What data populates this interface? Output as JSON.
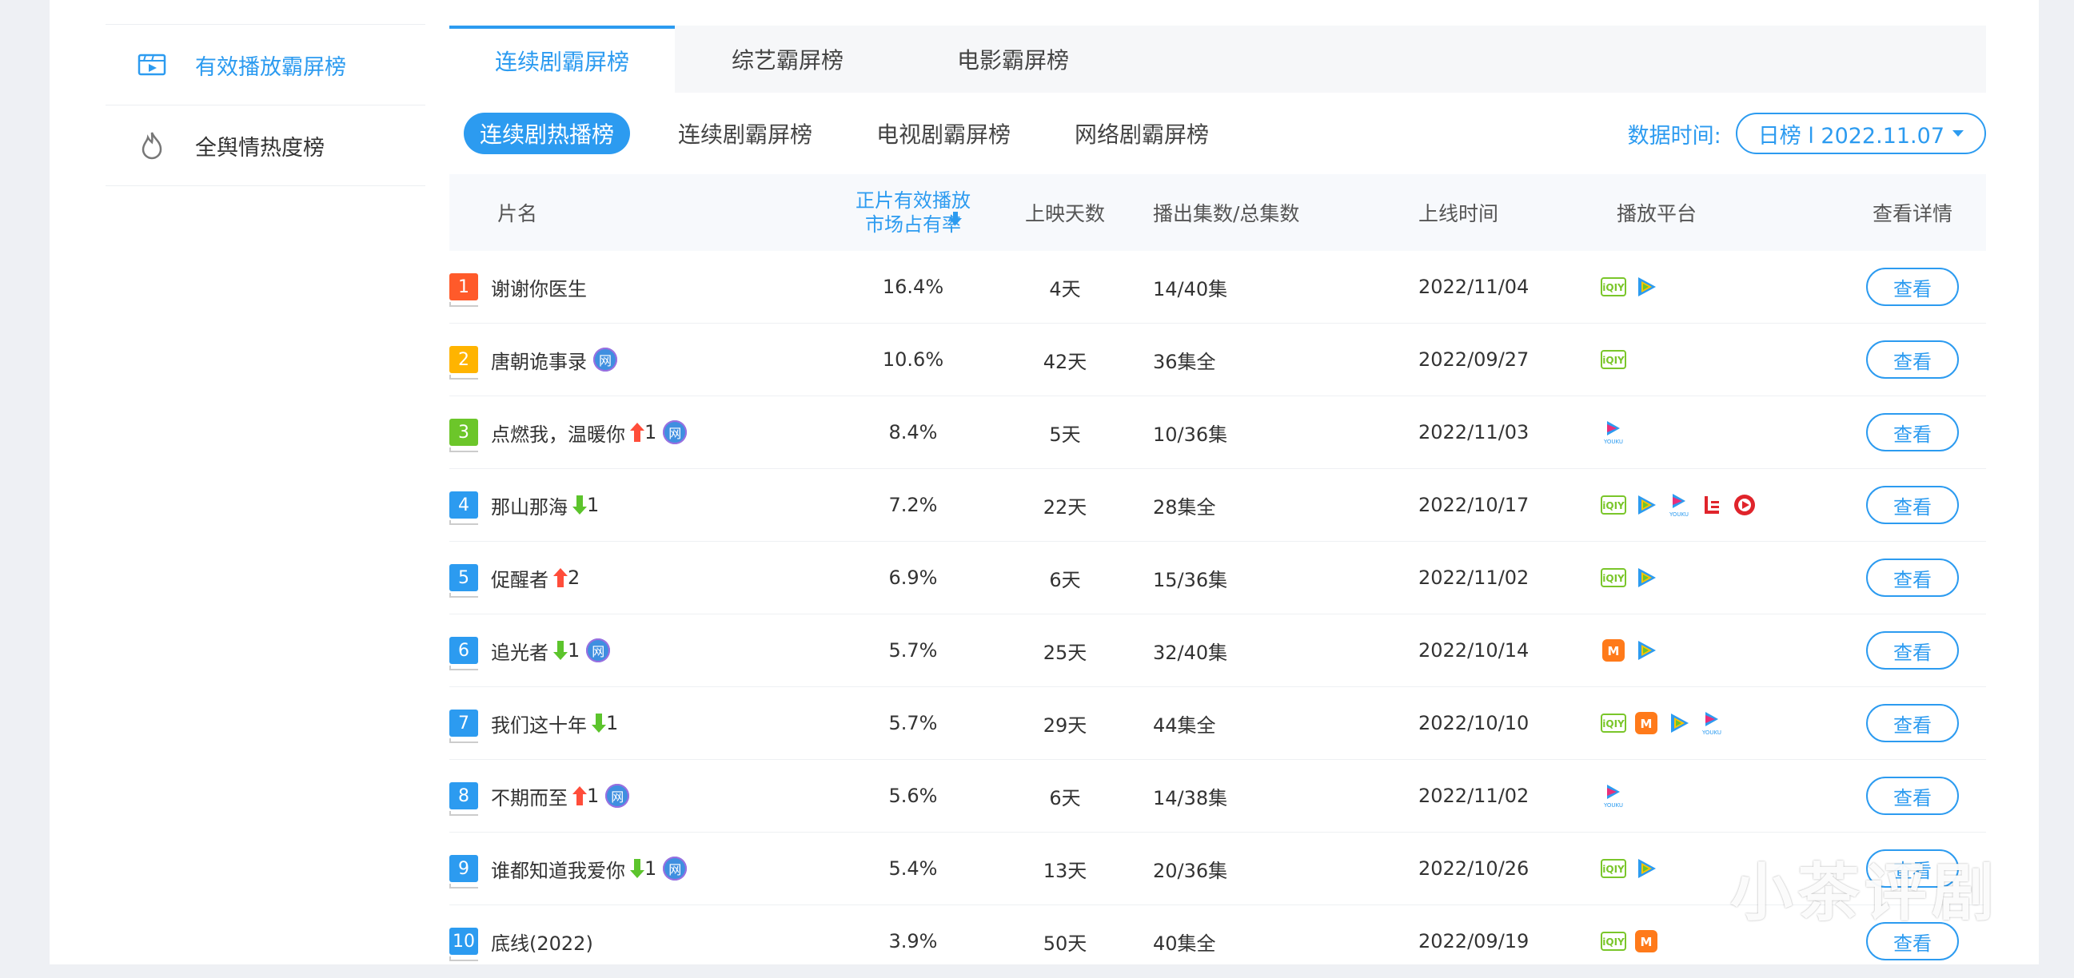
{
  "sidebar": {
    "items": [
      {
        "label": "有效播放霸屏榜",
        "icon": "film-icon",
        "active": true
      },
      {
        "label": "全舆情热度榜",
        "icon": "flame-icon",
        "active": false
      }
    ]
  },
  "top_tabs": [
    {
      "label": "连续剧霸屏榜",
      "active": true
    },
    {
      "label": "综艺霸屏榜",
      "active": false
    },
    {
      "label": "电影霸屏榜",
      "active": false
    }
  ],
  "sub_tabs": [
    {
      "label": "连续剧热播榜",
      "active": true
    },
    {
      "label": "连续剧霸屏榜",
      "active": false
    },
    {
      "label": "电视剧霸屏榜",
      "active": false
    },
    {
      "label": "网络剧霸屏榜",
      "active": false
    }
  ],
  "date": {
    "label": "数据时间:",
    "value": "日榜 l 2022.11.07"
  },
  "table": {
    "headers": {
      "name": "片名",
      "share_line1": "正片有效播放",
      "share_line2": "市场占有率",
      "days": "上映天数",
      "eps": "播出集数/总集数",
      "date": "上线时间",
      "platform": "播放平台",
      "detail": "查看详情"
    },
    "detail_label": "查看",
    "rows": [
      {
        "rank": "1",
        "color": "#ff5a2a",
        "name": "谢谢你医生",
        "trend": "",
        "change": "",
        "net": false,
        "share": "16.4%",
        "days": "4天",
        "eps": "14/40集",
        "date": "2022/11/04",
        "platforms": [
          "iqiyi",
          "tencent"
        ]
      },
      {
        "rank": "2",
        "color": "#ffb400",
        "name": "唐朝诡事录",
        "trend": "",
        "change": "",
        "net": true,
        "share": "10.6%",
        "days": "42天",
        "eps": "36集全",
        "date": "2022/09/27",
        "platforms": [
          "iqiyi"
        ]
      },
      {
        "rank": "3",
        "color": "#6cc62a",
        "name": "点燃我，温暖你",
        "trend": "up",
        "change": "1",
        "net": true,
        "share": "8.4%",
        "days": "5天",
        "eps": "10/36集",
        "date": "2022/11/03",
        "platforms": [
          "youku"
        ]
      },
      {
        "rank": "4",
        "color": "#2c9bf0",
        "name": "那山那海",
        "trend": "down",
        "change": "1",
        "net": false,
        "share": "7.2%",
        "days": "22天",
        "eps": "28集全",
        "date": "2022/10/17",
        "platforms": [
          "iqiyi",
          "tencent",
          "youku",
          "letv",
          "sohu"
        ]
      },
      {
        "rank": "5",
        "color": "#2c9bf0",
        "name": "促醒者",
        "trend": "up",
        "change": "2",
        "net": false,
        "share": "6.9%",
        "days": "6天",
        "eps": "15/36集",
        "date": "2022/11/02",
        "platforms": [
          "iqiyi",
          "tencent"
        ]
      },
      {
        "rank": "6",
        "color": "#2c9bf0",
        "name": "追光者",
        "trend": "down",
        "change": "1",
        "net": true,
        "share": "5.7%",
        "days": "25天",
        "eps": "32/40集",
        "date": "2022/10/14",
        "platforms": [
          "mango",
          "tencent"
        ]
      },
      {
        "rank": "7",
        "color": "#2c9bf0",
        "name": "我们这十年",
        "trend": "down",
        "change": "1",
        "net": false,
        "share": "5.7%",
        "days": "29天",
        "eps": "44集全",
        "date": "2022/10/10",
        "platforms": [
          "iqiyi",
          "mango",
          "tencent",
          "youku"
        ]
      },
      {
        "rank": "8",
        "color": "#2c9bf0",
        "name": "不期而至",
        "trend": "up",
        "change": "1",
        "net": true,
        "share": "5.6%",
        "days": "6天",
        "eps": "14/38集",
        "date": "2022/11/02",
        "platforms": [
          "youku"
        ]
      },
      {
        "rank": "9",
        "color": "#2c9bf0",
        "name": "谁都知道我爱你",
        "trend": "down",
        "change": "1",
        "net": true,
        "share": "5.4%",
        "days": "13天",
        "eps": "20/36集",
        "date": "2022/10/26",
        "platforms": [
          "iqiyi",
          "tencent"
        ]
      },
      {
        "rank": "10",
        "color": "#2c9bf0",
        "name": "底线(2022)",
        "trend": "",
        "change": "",
        "net": false,
        "share": "3.9%",
        "days": "50天",
        "eps": "40集全",
        "date": "2022/09/19",
        "platforms": [
          "iqiyi",
          "mango"
        ]
      }
    ]
  },
  "net_badge": "网",
  "watermark": "小茶评剧",
  "colors": {
    "accent": "#2c9bf0",
    "up": "#ff4d3a",
    "down": "#5cc42c"
  }
}
